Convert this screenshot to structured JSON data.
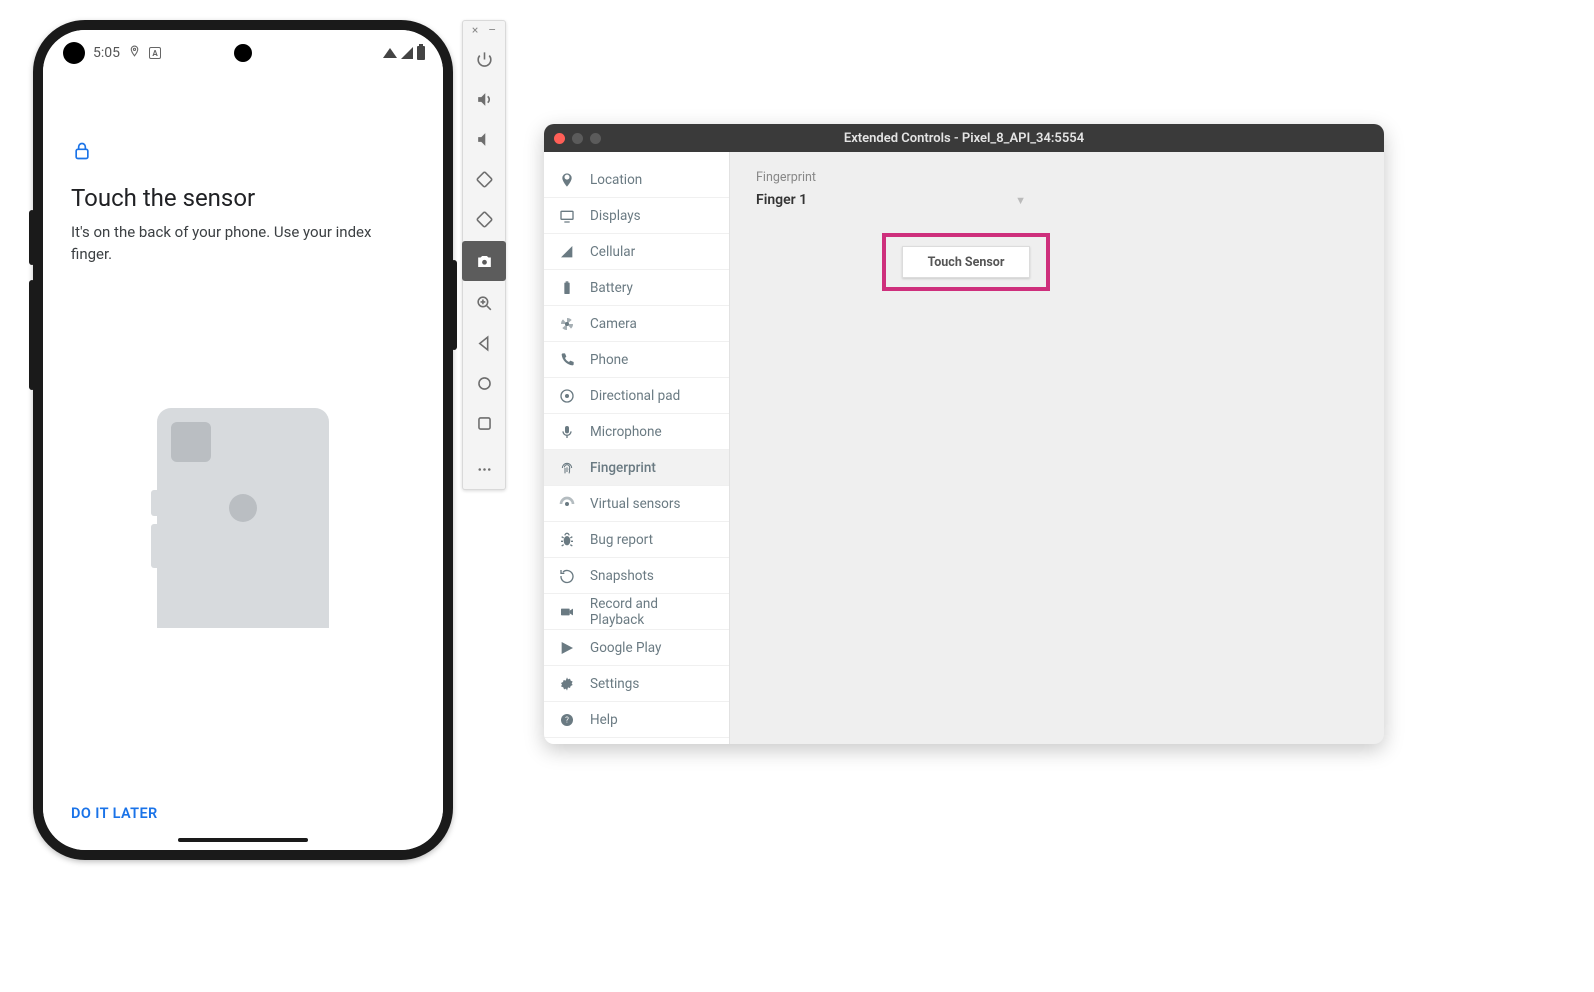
{
  "phone": {
    "status": {
      "time": "5:05"
    },
    "screen": {
      "title": "Touch the sensor",
      "subtitle": "It's on the back of your phone. Use your index finger.",
      "do_later": "DO IT LATER"
    }
  },
  "toolbar": {
    "close": "×",
    "minimize": "–"
  },
  "extended": {
    "title": "Extended Controls - Pixel_8_API_34:5554",
    "sidebar": [
      {
        "label": "Location",
        "icon": "location"
      },
      {
        "label": "Displays",
        "icon": "displays"
      },
      {
        "label": "Cellular",
        "icon": "cellular"
      },
      {
        "label": "Battery",
        "icon": "battery"
      },
      {
        "label": "Camera",
        "icon": "camera"
      },
      {
        "label": "Phone",
        "icon": "phone"
      },
      {
        "label": "Directional pad",
        "icon": "dpad"
      },
      {
        "label": "Microphone",
        "icon": "mic"
      },
      {
        "label": "Fingerprint",
        "icon": "fingerprint",
        "selected": true
      },
      {
        "label": "Virtual sensors",
        "icon": "sensors"
      },
      {
        "label": "Bug report",
        "icon": "bug"
      },
      {
        "label": "Snapshots",
        "icon": "snapshot"
      },
      {
        "label": "Record and Playback",
        "icon": "record"
      },
      {
        "label": "Google Play",
        "icon": "play"
      },
      {
        "label": "Settings",
        "icon": "settings"
      },
      {
        "label": "Help",
        "icon": "help"
      }
    ],
    "panel": {
      "section_label": "Fingerprint",
      "selected_finger": "Finger 1",
      "touch_button": "Touch Sensor"
    }
  }
}
